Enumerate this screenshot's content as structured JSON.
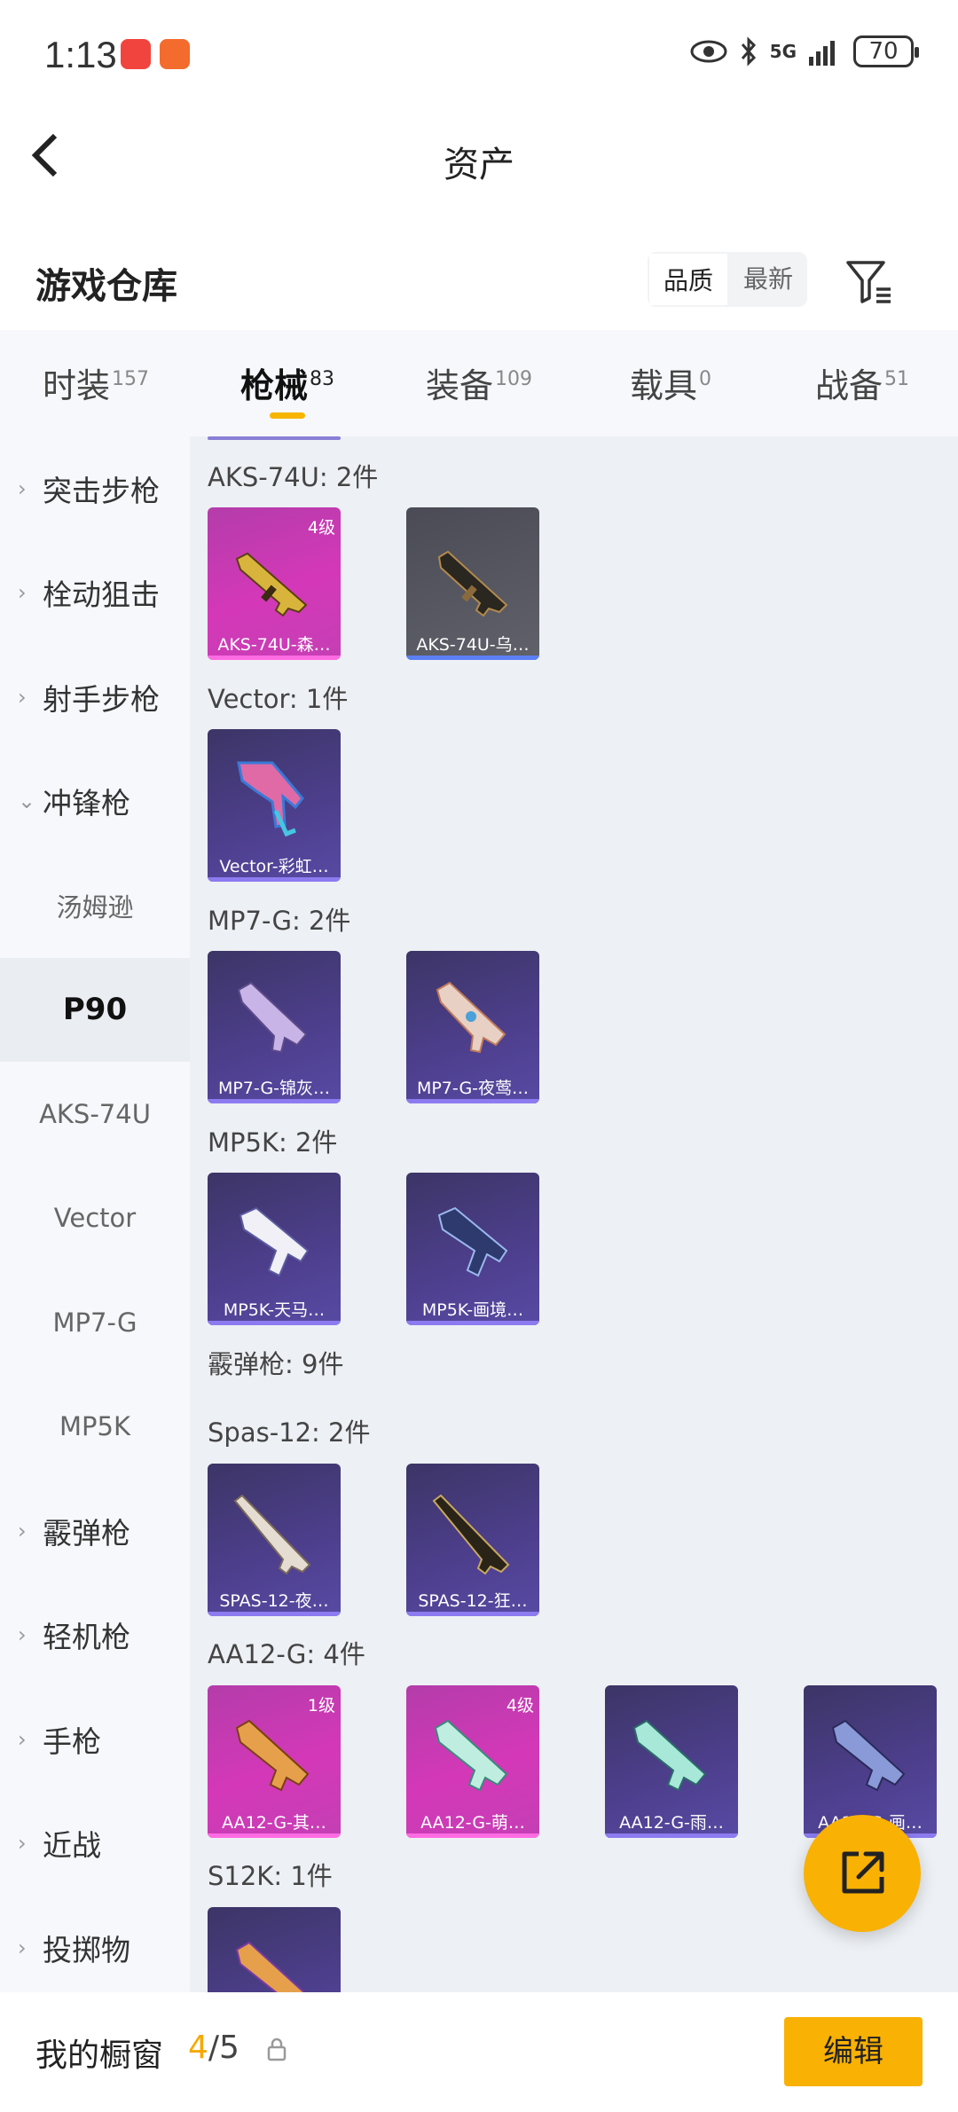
{
  "status": {
    "time": "1:13",
    "battery": "70",
    "network": "5G"
  },
  "nav": {
    "title": "资产"
  },
  "header": {
    "title": "游戏仓库",
    "sort_quality": "品质",
    "sort_newest": "最新"
  },
  "tabs": [
    {
      "label": "时装",
      "count": "157"
    },
    {
      "label": "枪械",
      "count": "83"
    },
    {
      "label": "装备",
      "count": "109"
    },
    {
      "label": "载具",
      "count": "0"
    },
    {
      "label": "战备",
      "count": "51"
    }
  ],
  "categories": [
    {
      "label": "突击步枪"
    },
    {
      "label": "栓动狙击"
    },
    {
      "label": "射手步枪"
    },
    {
      "label": "冲锋枪"
    },
    {
      "label": "汤姆逊"
    },
    {
      "label": "P90"
    },
    {
      "label": "AKS-74U"
    },
    {
      "label": "Vector"
    },
    {
      "label": "MP7-G"
    },
    {
      "label": "MP5K"
    },
    {
      "label": "霰弹枪"
    },
    {
      "label": "轻机枪"
    },
    {
      "label": "手枪"
    },
    {
      "label": "近战"
    },
    {
      "label": "投掷物"
    }
  ],
  "groups": [
    {
      "title": "AKS-74U: 2件",
      "items": [
        {
          "label": "AKS-74U-森…",
          "quality": "pink",
          "level": "4级"
        },
        {
          "label": "AKS-74U-乌…",
          "quality": "gray",
          "level": ""
        }
      ]
    },
    {
      "title": "Vector: 1件",
      "items": [
        {
          "label": "Vector-彩虹…",
          "quality": "purple",
          "level": ""
        }
      ]
    },
    {
      "title": "MP7-G: 2件",
      "items": [
        {
          "label": "MP7-G-锦灰…",
          "quality": "purple",
          "level": ""
        },
        {
          "label": "MP7-G-夜莺…",
          "quality": "purple",
          "level": ""
        }
      ]
    },
    {
      "title": "MP5K: 2件",
      "items": [
        {
          "label": "MP5K-天马…",
          "quality": "purple",
          "level": ""
        },
        {
          "label": "MP5K-画境…",
          "quality": "purple",
          "level": ""
        }
      ]
    },
    {
      "title": "霰弹枪: 9件",
      "items": []
    },
    {
      "title": "Spas-12: 2件",
      "items": [
        {
          "label": "SPAS-12-夜…",
          "quality": "purple",
          "level": ""
        },
        {
          "label": "SPAS-12-狂…",
          "quality": "purple",
          "level": ""
        }
      ]
    },
    {
      "title": "AA12-G: 4件",
      "items": [
        {
          "label": "AA12-G-其…",
          "quality": "pink",
          "level": "1级"
        },
        {
          "label": "AA12-G-萌…",
          "quality": "pink",
          "level": "4级"
        },
        {
          "label": "AA12-G-雨…",
          "quality": "purple",
          "level": ""
        },
        {
          "label": "AA12-G-画…",
          "quality": "purple",
          "level": ""
        }
      ]
    },
    {
      "title": "S12K: 1件",
      "items": [
        {
          "label": "",
          "quality": "purple",
          "level": ""
        }
      ]
    }
  ],
  "bottom": {
    "label": "我的橱窗",
    "count_current": "4",
    "count_total": "/5",
    "edit": "编辑"
  },
  "colors": {
    "accent": "#f9b104",
    "pink_quality": "#d438b8",
    "purple_quality": "#4e3f8e",
    "gray_quality": "#55565f"
  }
}
